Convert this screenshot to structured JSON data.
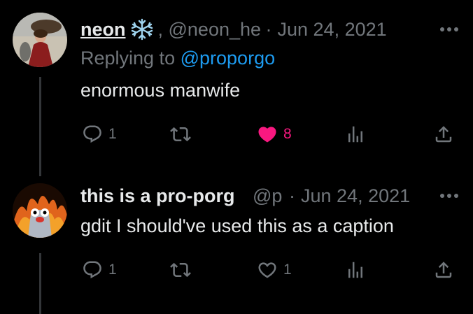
{
  "colors": {
    "background": "#000000",
    "text_primary": "#e7e9ea",
    "text_secondary": "#71767b",
    "link": "#1d9bf0",
    "like": "#f91880",
    "thread_line": "#333639"
  },
  "tweets": [
    {
      "display_name": "neon",
      "handle": ", @neon_hea",
      "date": "Jun 24, 2021",
      "more": "•••",
      "replying_prefix": "Replying to",
      "replying_to": "@proporgo",
      "text": "enormous manwife",
      "replies": "1",
      "retweets": "",
      "likes": "8",
      "liked": true,
      "icons": [
        "reply-icon",
        "retweet-icon",
        "heart-filled-icon",
        "views-icon",
        "share-icon"
      ]
    },
    {
      "display_name": "this is a pro-porg",
      "handle": "@p",
      "date": "Jun 24, 2021",
      "more": "•••",
      "text": "gdit I should've used this as a caption",
      "replies": "1",
      "retweets": "",
      "likes": "1",
      "liked": false,
      "icons": [
        "reply-icon",
        "retweet-icon",
        "heart-outline-icon",
        "views-icon",
        "share-icon"
      ]
    }
  ]
}
